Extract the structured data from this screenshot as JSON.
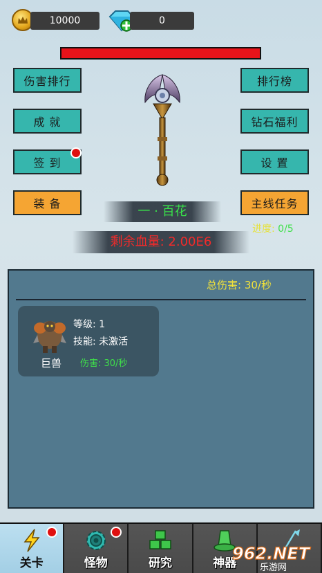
{
  "currency": {
    "coins": "10000",
    "coins_icon": "crown-coin-icon",
    "diamonds": "0",
    "diamonds_icon": "diamond-plus-icon"
  },
  "boss": {
    "hp_fraction": 1.0,
    "stage_name": "一 · 百花",
    "remaining_hp": "剩余血量: 2.00E6",
    "progress_label": "进度: ",
    "progress_value": "0/5"
  },
  "left_buttons": [
    {
      "label": "伤害排行",
      "color": "#36b6ad"
    },
    {
      "label": "成 就",
      "color": "#36b6ad"
    },
    {
      "label": "签 到",
      "color": "#36b6ad",
      "badge": true
    },
    {
      "label": "装 备",
      "color": "#f5a533"
    }
  ],
  "right_buttons": [
    {
      "label": "排行榜",
      "color": "#36b6ad"
    },
    {
      "label": "钻石福利",
      "color": "#36b6ad"
    },
    {
      "label": "设 置",
      "color": "#36b6ad"
    },
    {
      "label": "主线任务",
      "color": "#f5a533"
    }
  ],
  "panel": {
    "total_damage": "总伤害: 30/秒",
    "monster": {
      "name": "巨兽",
      "level": "等级: 1",
      "skill": "技能: 未激活",
      "damage": "伤害: 30/秒"
    }
  },
  "nav": {
    "tabs": [
      {
        "label": "关卡",
        "icon": "lightning-icon",
        "active": true,
        "badge": true
      },
      {
        "label": "怪物",
        "icon": "gear-icon",
        "active": false,
        "badge": true
      },
      {
        "label": "研究",
        "icon": "cubes-icon",
        "active": false,
        "badge": false
      },
      {
        "label": "神器",
        "icon": "hat-icon",
        "active": false,
        "badge": false
      },
      {
        "label": "",
        "icon": "flag-icon",
        "active": false,
        "badge": false
      }
    ]
  },
  "watermark": "962.NET 乐游网"
}
